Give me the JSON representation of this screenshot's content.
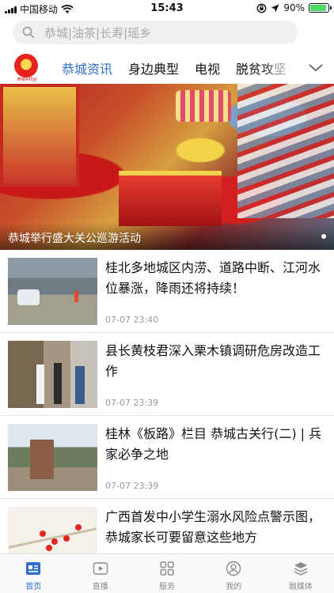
{
  "status_bar": {
    "carrier": "中国移动",
    "time": "15:43",
    "battery_text": "90%",
    "battery_level": 0.9
  },
  "search": {
    "placeholder": "恭城|油茶|长寿|瑶乡"
  },
  "nav": {
    "logo_text": "恭城手机台",
    "tabs": [
      {
        "label": "恭城资讯",
        "active": true
      },
      {
        "label": "身边典型",
        "active": false
      },
      {
        "label": "电视",
        "active": false
      },
      {
        "label": "脱贫攻坚",
        "active": false
      }
    ],
    "more_icon": "chevron-down-icon"
  },
  "banner": {
    "caption": "恭城举行盛大关公巡游活动"
  },
  "news": [
    {
      "title": "桂北多地城区内涝、道路中断、江河水位暴涨，降雨还将持续！",
      "time": "07-07 23:40"
    },
    {
      "title": "县长黄枝君深入栗木镇调研危房改造工作",
      "time": "07-07 23:39"
    },
    {
      "title": "桂林《板路》栏目 恭城古关行(二) | 兵家必争之地",
      "time": "07-07 23:39"
    },
    {
      "title": "广西首发中小学生溺水风险点警示图，恭城家长可要留意这些地方",
      "time": ""
    }
  ],
  "tabbar": [
    {
      "label": "首页",
      "icon": "news-icon",
      "active": true
    },
    {
      "label": "直播",
      "icon": "play-icon",
      "active": false
    },
    {
      "label": "服务",
      "icon": "grid-icon",
      "active": false
    },
    {
      "label": "我的",
      "icon": "profile-icon",
      "active": false
    },
    {
      "label": "融媒体",
      "icon": "media-icon",
      "active": false
    }
  ],
  "colors": {
    "accent": "#2f6fd0",
    "battery": "#4cd964"
  }
}
